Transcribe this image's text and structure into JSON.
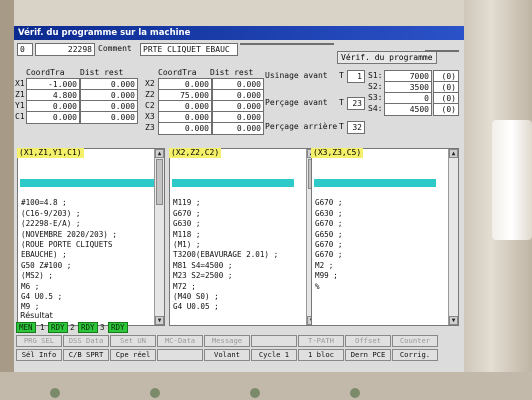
{
  "window": {
    "title": "Vérif. du programme sur la machine"
  },
  "program": {
    "index": "0",
    "number": "22298",
    "comment_label": "Comment",
    "comment_value": "PRTE CLIQUET EBAUC",
    "verify_button": "Vérif. du programme"
  },
  "coords": {
    "col1_header": "CoordTra",
    "col1_dist_header": "Dist rest",
    "col2_header": "CoordTra",
    "col2_dist_header": "Dist rest",
    "left_rows": [
      {
        "axis": "X1",
        "value": "-1.000",
        "dist": "0.000"
      },
      {
        "axis": "Z1",
        "value": "4.800",
        "dist": "0.000"
      },
      {
        "axis": "Y1",
        "value": "0.000",
        "dist": "0.000"
      },
      {
        "axis": "C1",
        "value": "0.000",
        "dist": "0.000"
      }
    ],
    "right_rows": [
      {
        "axis": "X2",
        "value": "0.000",
        "dist": "0.000"
      },
      {
        "axis": "Z2",
        "value": "75.000",
        "dist": "0.000"
      },
      {
        "axis": "C2",
        "value": "0.000",
        "dist": "0.000"
      },
      {
        "axis": "X3",
        "value": "0.000",
        "dist": "0.000"
      },
      {
        "axis": "Z3",
        "value": "0.000",
        "dist": "0.000"
      }
    ]
  },
  "ops": {
    "usinage_label": "Usinage avant",
    "usinage_t": "T",
    "usinage_t_value": "1",
    "percage_label": "Perçage avant",
    "percage_t": "T",
    "percage_t_value": "23",
    "percage_ar_label": "Perçage arrière",
    "percage_ar_t": "T",
    "percage_ar_t_value": "32"
  },
  "spindles": [
    {
      "name": "S1:",
      "value": "7000",
      "flag": "(0)"
    },
    {
      "name": "S2:",
      "value": "3500",
      "flag": "(0)"
    },
    {
      "name": "S3:",
      "value": "0",
      "flag": "(0)"
    },
    {
      "name": "S4:",
      "value": "4500",
      "flag": "(0)"
    }
  ],
  "panels": [
    {
      "header": "(X1,Z1,Y1,C1)",
      "lines": [
        "",
        "#100=4.8 ;",
        "(C16-9/203) ;",
        "(22298-E/A) ;",
        "(NOVEMBRE 2020/203) ;",
        "(ROUE PORTE CLIQUETS",
        "EBAUCHE) ;",
        "G50 Z#100 ;",
        "(MS2) ;",
        "M6 ;",
        "G4 U0.5 ;",
        "M9 ;"
      ]
    },
    {
      "header": "(X2,Z2,C2)",
      "lines": [
        "",
        "M119 ;",
        "G670 ;",
        "G630 ;",
        "M118 ;",
        "(M1) ;",
        "T3200(EBAVURAGE 2.01) ;",
        "M81 S4=4500 ;",
        "M23 S2=2500 ;",
        "M72 ;",
        "(M40 S0) ;",
        "G4 U0.05 ;"
      ]
    },
    {
      "header": "(X3,Z3,C5)",
      "lines": [
        "",
        "G670 ;",
        "G630 ;",
        "G670 ;",
        "G650 ;",
        "G670 ;",
        "G670 ;",
        "M2 ;",
        "M99 ;",
        "%"
      ]
    }
  ],
  "result": {
    "label": "Résultat"
  },
  "status": [
    {
      "label": "MEN",
      "num": "1"
    },
    {
      "label": "RDY",
      "num": "2"
    },
    {
      "label": "RDY",
      "num": "3"
    },
    {
      "label": "RDY",
      "num": ""
    }
  ],
  "softkeys_row1": [
    "PRG SEL",
    "DSS Data",
    "Set UN",
    "MC-Data",
    "Message",
    "",
    "T-PATH",
    "Offset",
    "Counter"
  ],
  "softkeys_row2": [
    "Sél Info",
    "C/B SPRT",
    "Cpe réel",
    "",
    "Volant",
    "Cycle 1",
    "1 bloc",
    "Dern PCE",
    "Corrig."
  ]
}
